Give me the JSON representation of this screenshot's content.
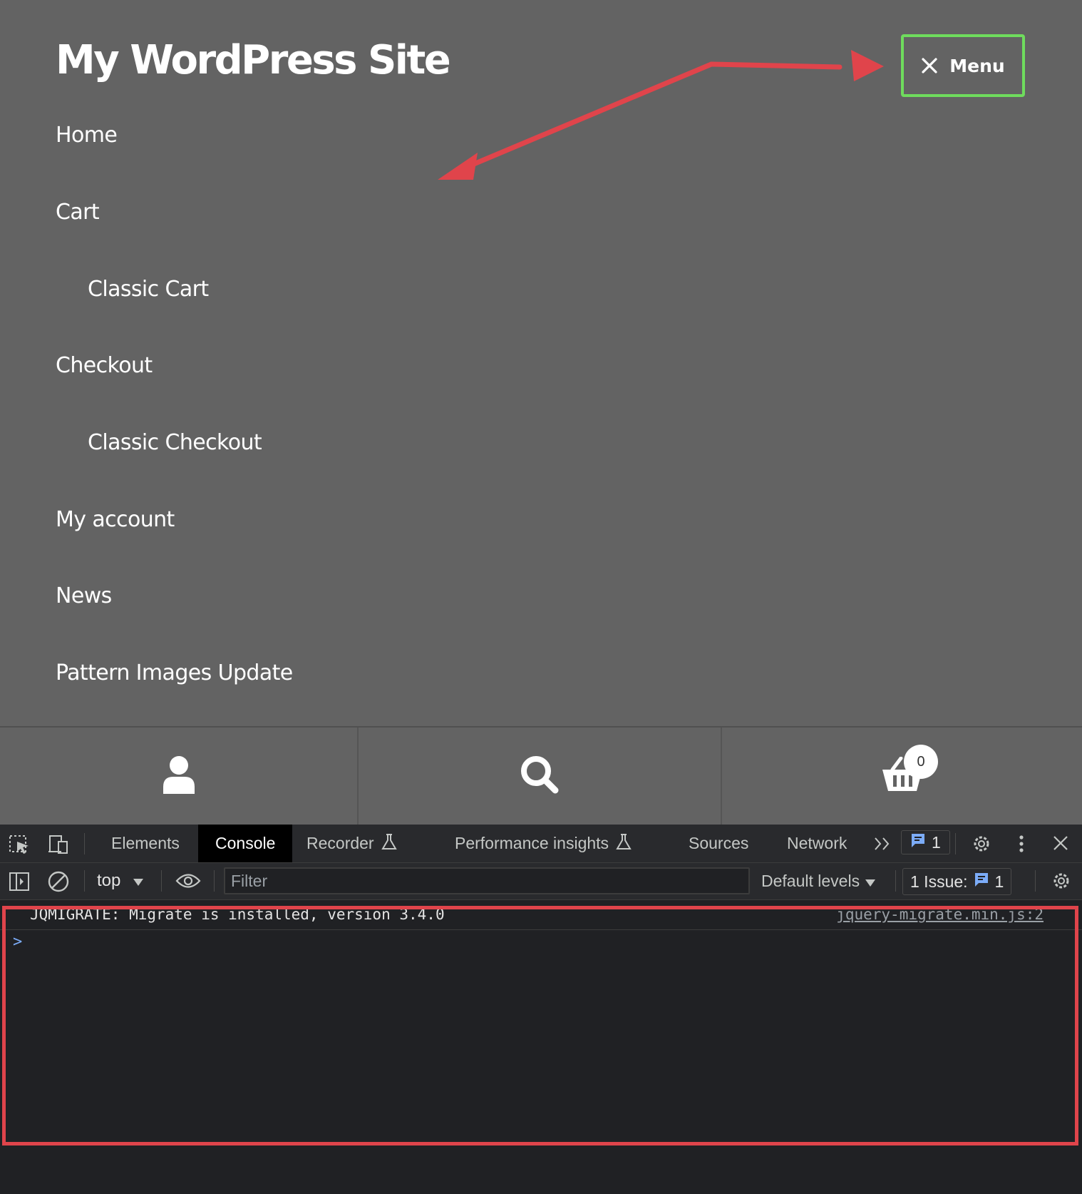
{
  "site": {
    "title": "My WordPress Site",
    "menu_button_label": "Menu",
    "nav_items": [
      {
        "label": "Home"
      },
      {
        "label": "Cart"
      },
      {
        "label": "Classic Cart"
      },
      {
        "label": "Checkout"
      },
      {
        "label": "Classic Checkout"
      },
      {
        "label": "My account"
      },
      {
        "label": "News"
      },
      {
        "label": "Pattern Images Update"
      }
    ]
  },
  "bottom_bar": {
    "account_icon": "user-icon",
    "search_icon": "search-icon",
    "cart_icon": "basket-icon",
    "cart_count": "0"
  },
  "devtools": {
    "tabs": [
      "Elements",
      "Console",
      "Recorder",
      "Performance insights",
      "Sources",
      "Network"
    ],
    "active_tab": "Console",
    "messages_badge_count": "1",
    "toolbar": {
      "context": "top",
      "filter_placeholder": "Filter",
      "levels_label": "Default levels",
      "issues_label": "1 Issue:",
      "issues_count": "1"
    },
    "console": {
      "message": "JQMIGRATE: Migrate is installed, version 3.4.0",
      "source": "jquery-migrate.min.js:2",
      "prompt_symbol": ">"
    }
  },
  "annotations": {
    "arrow_color": "#e0444b",
    "menu_highlight_color": "#6fdc5d",
    "console_highlight_color": "#e0444b"
  }
}
